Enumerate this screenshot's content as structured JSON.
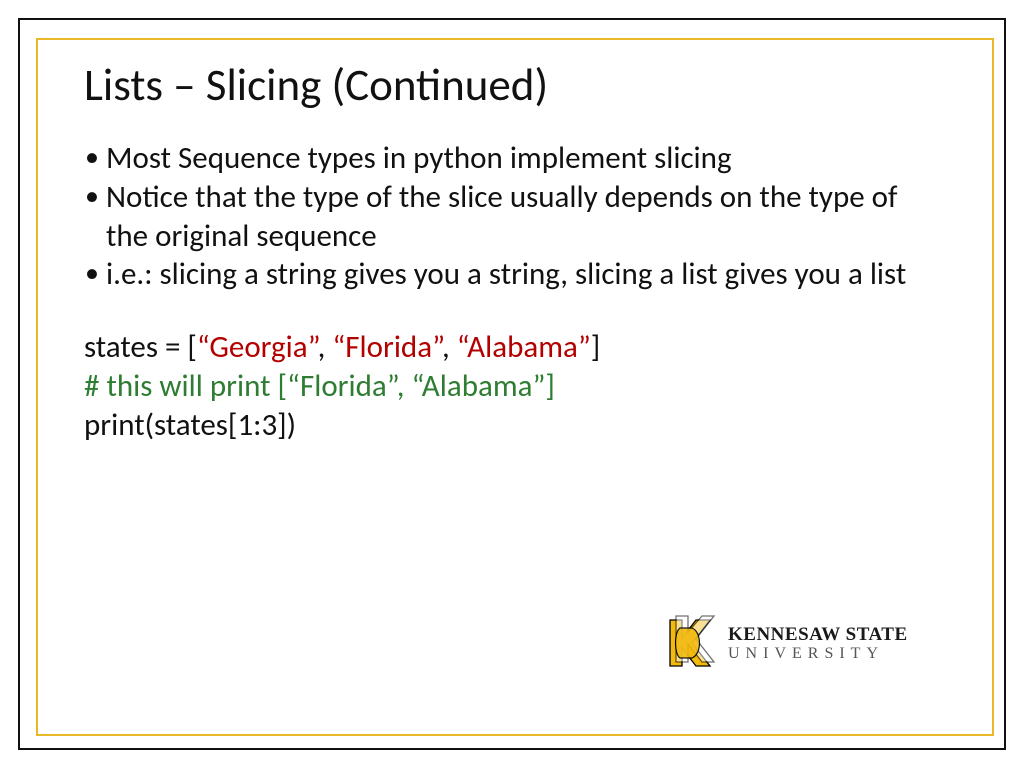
{
  "title": "Lists – Slicing (Continued)",
  "bullets": [
    "Most Sequence types in python implement slicing",
    "Notice that the type of the slice usually depends on the type of the original sequence",
    "i.e.: slicing a string gives you a string, slicing a list gives you a list"
  ],
  "code": {
    "line1_pre": "states = [",
    "line1_s1": "“Georgia”",
    "line1_c1": ", ",
    "line1_s2": "“Florida”",
    "line1_c2": ", ",
    "line1_s3": "“Alabama”",
    "line1_post": "]",
    "line2_comment": "# this will print [“Florida”, “Alabama”]",
    "line3": "print(states[1:3])"
  },
  "logo": {
    "top": "KENNESAW STATE",
    "bottom": "UNIVERSITY"
  }
}
